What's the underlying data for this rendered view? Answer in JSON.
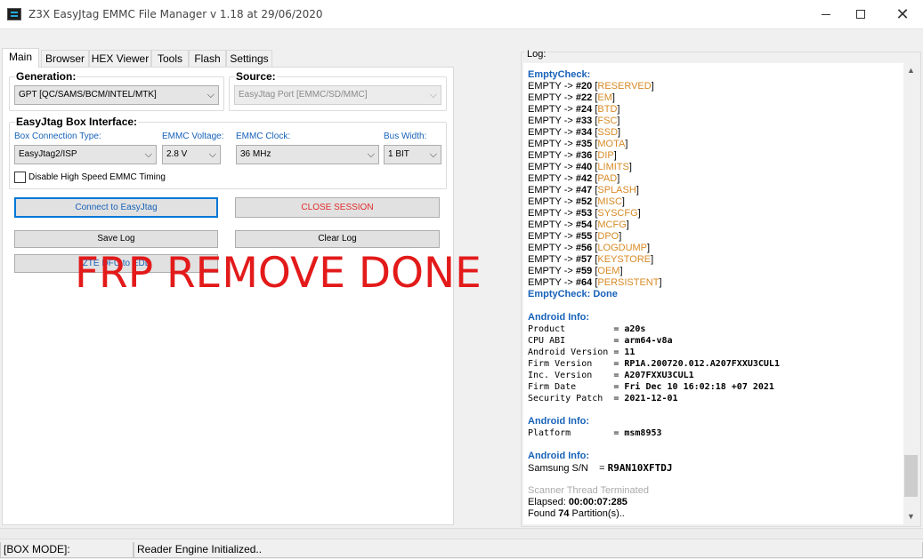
{
  "window": {
    "title": "Z3X EasyJtag EMMC File Manager v 1.18 at 29/06/2020"
  },
  "tabs": [
    "Main",
    "Browser",
    "HEX Viewer",
    "Tools",
    "Flash",
    "Settings"
  ],
  "main": {
    "generation": {
      "title": "Generation:",
      "value": "GPT [QC/SAMS/BCM/INTEL/MTK]"
    },
    "source": {
      "title": "Source:",
      "value": "EasyJtag Port [EMMC/SD/MMC]"
    },
    "interface": {
      "title": "EasyJtag Box Interface:",
      "box_connection_label": "Box Connection Type:",
      "box_connection_value": "EasyJtag2/ISP",
      "emmc_voltage_label": "EMMC Voltage:",
      "emmc_voltage_value": "2.8 V",
      "emmc_clock_label": "EMMC Clock:",
      "emmc_clock_value": "36 MHz",
      "bus_width_label": "Bus Width:",
      "bus_width_value": "1 BIT",
      "high_speed_label": "Disable High Speed EMMC Timing"
    },
    "buttons": {
      "connect": "Connect to EasyJtag",
      "close_session": "CLOSE SESSION",
      "save_log": "Save Log",
      "clear_log": "Clear Log",
      "zte_dfu": "ZTE DFU to EDL"
    },
    "overlay_text": "FRP REMOVE DONE",
    "accent_color": "#1762b8",
    "alert_color": "#e31a1a"
  },
  "log": {
    "title": "Log:",
    "empty_check_header": "EmptyCheck:",
    "empty_prefix": "EMPTY -> ",
    "empty_entries": [
      {
        "num": "#20",
        "name": "RESERVED"
      },
      {
        "num": "#22",
        "name": "EM"
      },
      {
        "num": "#24",
        "name": "BTD"
      },
      {
        "num": "#33",
        "name": "FSC"
      },
      {
        "num": "#34",
        "name": "SSD"
      },
      {
        "num": "#35",
        "name": "MOTA"
      },
      {
        "num": "#36",
        "name": "DIP"
      },
      {
        "num": "#40",
        "name": "LIMITS"
      },
      {
        "num": "#42",
        "name": "PAD"
      },
      {
        "num": "#47",
        "name": "SPLASH"
      },
      {
        "num": "#52",
        "name": "MISC"
      },
      {
        "num": "#53",
        "name": "SYSCFG"
      },
      {
        "num": "#54",
        "name": "MCFG"
      },
      {
        "num": "#55",
        "name": "DPO"
      },
      {
        "num": "#56",
        "name": "LOGDUMP"
      },
      {
        "num": "#57",
        "name": "KEYSTORE"
      },
      {
        "num": "#59",
        "name": "OEM"
      },
      {
        "num": "#64",
        "name": "PERSISTENT"
      }
    ],
    "empty_check_done": "EmptyCheck: Done",
    "android_info_header": "Android Info:",
    "android_info": [
      {
        "key": "Product         ",
        "val": "a20s"
      },
      {
        "key": "CPU ABI         ",
        "val": "arm64-v8a"
      },
      {
        "key": "Android Version ",
        "val": "11"
      },
      {
        "key": "Firm Version    ",
        "val": "RP1A.200720.012.A207FXXU3CUL1"
      },
      {
        "key": "Inc. Version    ",
        "val": "A207FXXU3CUL1"
      },
      {
        "key": "Firm Date       ",
        "val": "Fri Dec 10 16:02:18 +07 2021"
      },
      {
        "key": "Security Patch  ",
        "val": "2021-12-01"
      }
    ],
    "platform": {
      "key": "Platform        ",
      "val": "msm8953"
    },
    "serial": {
      "key": "Samsung S/N",
      "val": "R9AN10XFTDJ"
    },
    "scanner_terminated": "Scanner Thread Terminated",
    "elapsed_label": "Elapsed: ",
    "elapsed_value": "00:00:07:285",
    "found_prefix": "Found ",
    "found_count": "74",
    "found_suffix": " Partition(s).."
  },
  "status": {
    "mode": "[BOX MODE]:",
    "message": "Reader Engine Initialized.."
  }
}
